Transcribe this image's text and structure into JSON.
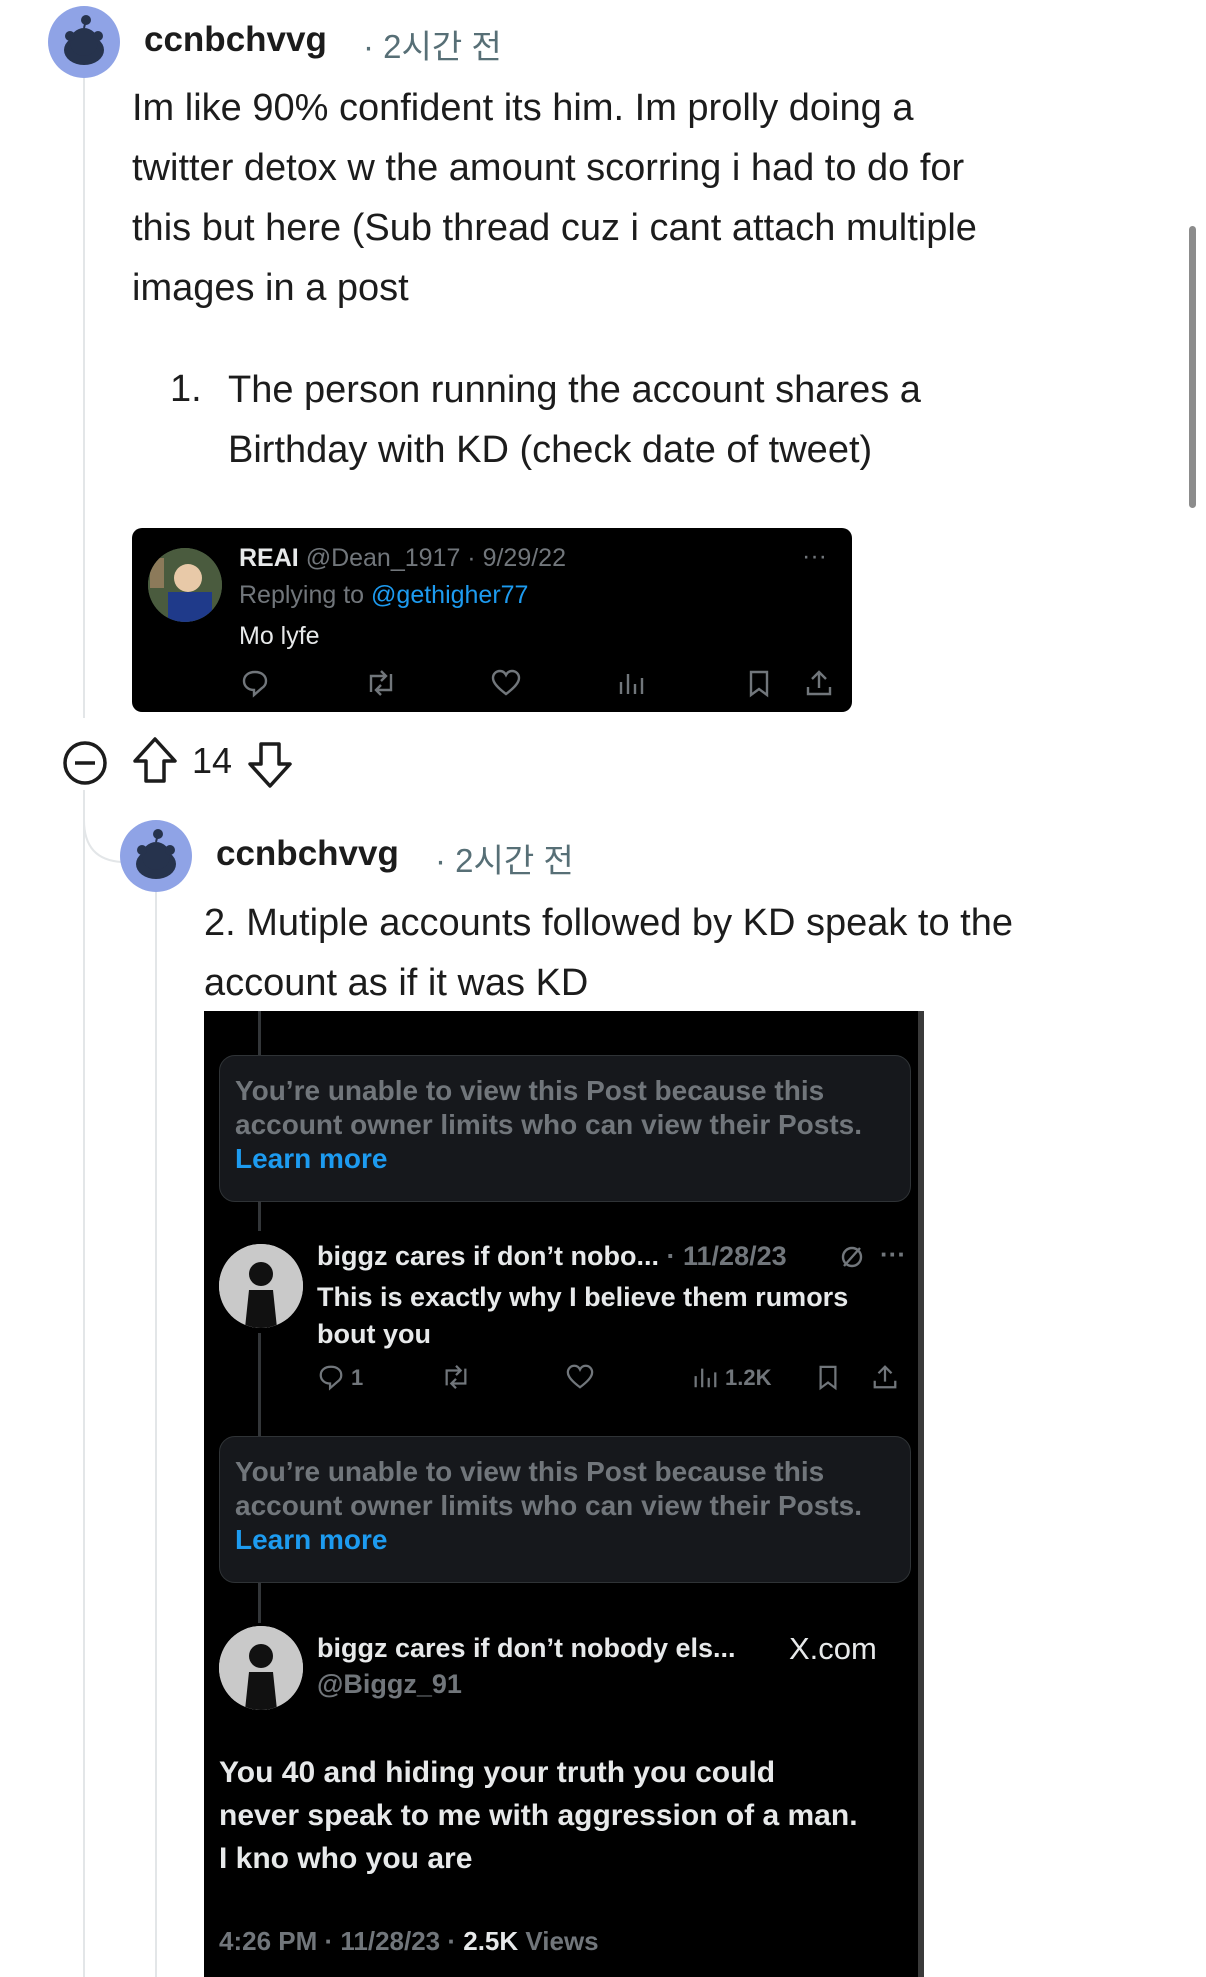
{
  "comment1": {
    "username": "ccnbchvvg",
    "time": "2시간 전",
    "text_lines": [
      "Im like 90% confident its him. Im prolly doing a",
      "twitter detox w the amount scorring i had to do for",
      "this but here (Sub thread cuz i cant attach multiple",
      "images in a post"
    ],
    "list_number": "1.",
    "list_lines": [
      "The person running the account shares a",
      "Birthday with KD (check date of tweet)"
    ],
    "tweet": {
      "name": "REAI",
      "handle_date": "@Dean_1917 · 9/29/22",
      "replying_prefix": "Replying to ",
      "replying_handle": "@gethigher77",
      "text": "Mo lyfe",
      "more": "···"
    },
    "votes": "14"
  },
  "comment2": {
    "username": "ccnbchvvg",
    "time": "2시간 전",
    "text_lines": [
      "2. Mutiple accounts followed by KD speak to the",
      "account as if it was KD"
    ],
    "screenshot": {
      "notice_text": "You’re unable to view this Post because this account owner limits who can view their Posts.",
      "learn_more": "Learn more",
      "reply": {
        "name": "biggz cares if don’t nobo...",
        "date": "· 11/28/23",
        "line1": "This is exactly why I believe them rumors",
        "line2": "bout you",
        "reply_count": "1",
        "views": "1.2K",
        "more": "···"
      },
      "notice2_text": "You’re unable to view this Post because this account owner limits who can view their Posts.",
      "learn_more2": "Learn more",
      "main": {
        "name": "biggz cares if don’t nobody els...",
        "handle": "@Biggz_91",
        "source": "X.com",
        "line1": "You 40 and hiding your truth you could",
        "line2": "never speak to me with aggression of a man.",
        "line3": "I kno who you are",
        "footer_time": "4:26 PM · 11/28/23 · ",
        "footer_views": "2.5K",
        "footer_views_label": " Views"
      }
    }
  }
}
